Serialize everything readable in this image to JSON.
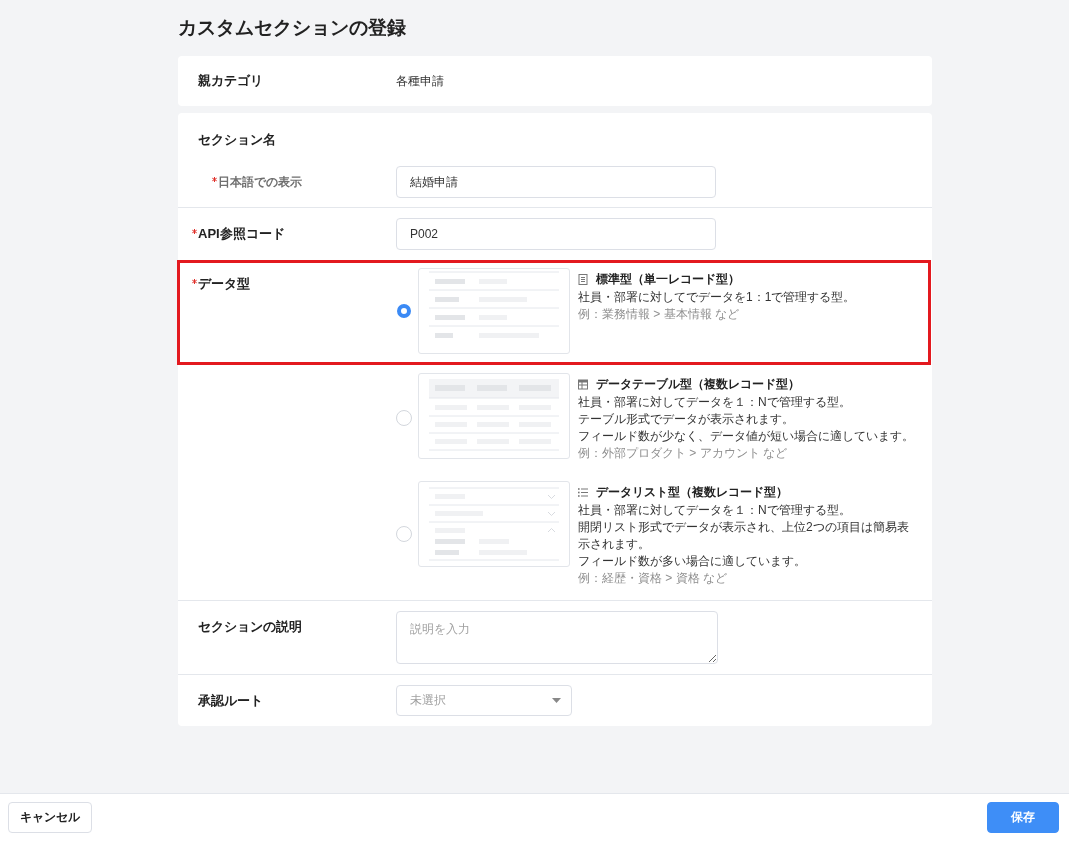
{
  "page": {
    "title": "カスタムセクションの登録"
  },
  "parent_category": {
    "label": "親カテゴリ",
    "value": "各種申請"
  },
  "section_name": {
    "label": "セクション名",
    "fields": [
      {
        "label": "日本語での表示",
        "required": true,
        "value": "結婚申請"
      }
    ]
  },
  "api_code": {
    "label": "API参照コード",
    "required": true,
    "value": "P002"
  },
  "data_type": {
    "label": "データ型",
    "required": true,
    "options": [
      {
        "kind": "single",
        "title": "標準型（単一レコード型）",
        "description": [
          "社員・部署に対してでデータを1：1で管理する型。"
        ],
        "example": "例：業務情報 > 基本情報 など",
        "selected": true,
        "highlighted": true
      },
      {
        "kind": "table",
        "title": "データテーブル型（複数レコード型）",
        "description": [
          "社員・部署に対してデータを１：Nで管理する型。",
          "テーブル形式でデータが表示されます。",
          "フィールド数が少なく、データ値が短い場合に適しています。"
        ],
        "example": "例：外部プロダクト > アカウント など",
        "selected": false,
        "highlighted": false
      },
      {
        "kind": "list",
        "title": "データリスト型（複数レコード型）",
        "description": [
          "社員・部署に対してデータを１：Nで管理する型。",
          "開閉リスト形式でデータが表示され、上位2つの項目は簡易表示されます。",
          "フィールド数が多い場合に適しています。"
        ],
        "example": "例：経歴・資格 > 資格 など",
        "selected": false,
        "highlighted": false
      }
    ]
  },
  "description": {
    "label": "セクションの説明",
    "placeholder": "説明を入力"
  },
  "approval_route": {
    "label": "承認ルート",
    "placeholder": "未選択"
  },
  "footer": {
    "buttons": [
      {
        "kind": "secondary",
        "label": "キャンセル"
      },
      {
        "kind": "primary",
        "label": "保存"
      }
    ]
  }
}
